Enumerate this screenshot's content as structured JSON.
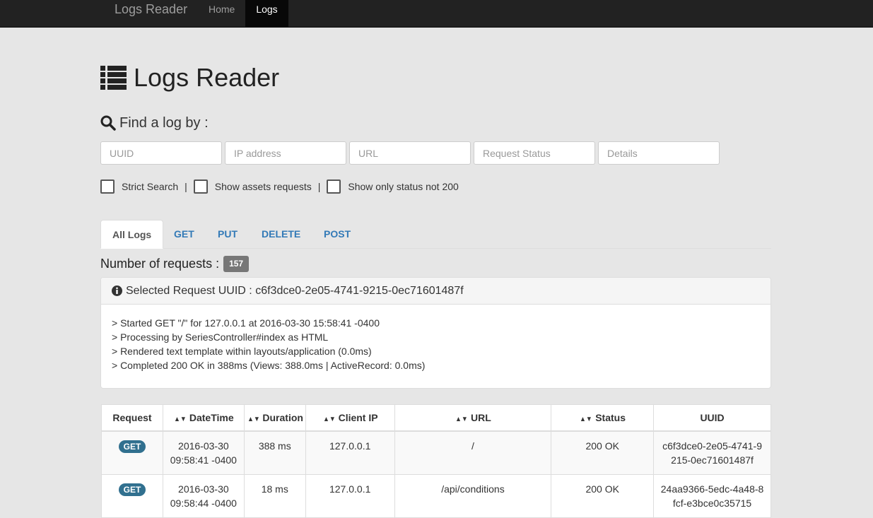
{
  "navbar": {
    "brand": "Logs Reader",
    "links": [
      {
        "label": "Home",
        "active": false
      },
      {
        "label": "Logs",
        "active": true
      }
    ]
  },
  "header": {
    "title": "Logs Reader",
    "icon": "list-icon"
  },
  "search": {
    "label": "Find a log by :",
    "icon": "search-icon",
    "fields": [
      {
        "placeholder": "UUID",
        "value": ""
      },
      {
        "placeholder": "IP address",
        "value": ""
      },
      {
        "placeholder": "URL",
        "value": ""
      },
      {
        "placeholder": "Request Status",
        "value": ""
      },
      {
        "placeholder": "Details",
        "value": ""
      }
    ],
    "options": [
      {
        "label": "Strict Search",
        "checked": false
      },
      {
        "label": "Show assets requests",
        "checked": false
      },
      {
        "label": "Show only status not 200",
        "checked": false
      }
    ],
    "separator": "|"
  },
  "tabs": [
    {
      "label": "All Logs",
      "active": true
    },
    {
      "label": "GET",
      "active": false
    },
    {
      "label": "PUT",
      "active": false
    },
    {
      "label": "DELETE",
      "active": false
    },
    {
      "label": "POST",
      "active": false
    }
  ],
  "count": {
    "label": "Number of requests :",
    "value": "157"
  },
  "selected": {
    "heading": "Selected Request UUID : c6f3dce0-2e05-4741-9215-0ec71601487f",
    "lines": [
      "> Started GET \"/\" for 127.0.0.1 at 2016-03-30 15:58:41 -0400",
      "> Processing by SeriesController#index as HTML",
      "> Rendered text template within layouts/application (0.0ms)",
      "> Completed 200 OK in 388ms (Views: 388.0ms | ActiveRecord: 0.0ms)"
    ]
  },
  "table": {
    "columns": [
      "Request",
      "DateTime",
      "Duration",
      "Client IP",
      "URL",
      "Status",
      "UUID"
    ],
    "sort_icon": "↕",
    "rows": [
      {
        "method": "GET",
        "datetime_1": "2016-03-30",
        "datetime_2": "09:58:41 -0400",
        "duration": "388 ms",
        "ip": "127.0.0.1",
        "url": "/",
        "status": "200 OK",
        "uuid_1": "c6f3dce0-2e05-4741-9",
        "uuid_2": "215-0ec71601487f"
      },
      {
        "method": "GET",
        "datetime_1": "2016-03-30",
        "datetime_2": "09:58:44 -0400",
        "duration": "18 ms",
        "ip": "127.0.0.1",
        "url": "/api/conditions",
        "status": "200 OK",
        "uuid_1": "24aa9366-5edc-4a48-8",
        "uuid_2": "fcf-e3bce0c35715"
      }
    ]
  },
  "colors": {
    "navbar": "#222222",
    "link": "#337ab7",
    "method_badge": "#31708f",
    "count_badge": "#777777"
  }
}
